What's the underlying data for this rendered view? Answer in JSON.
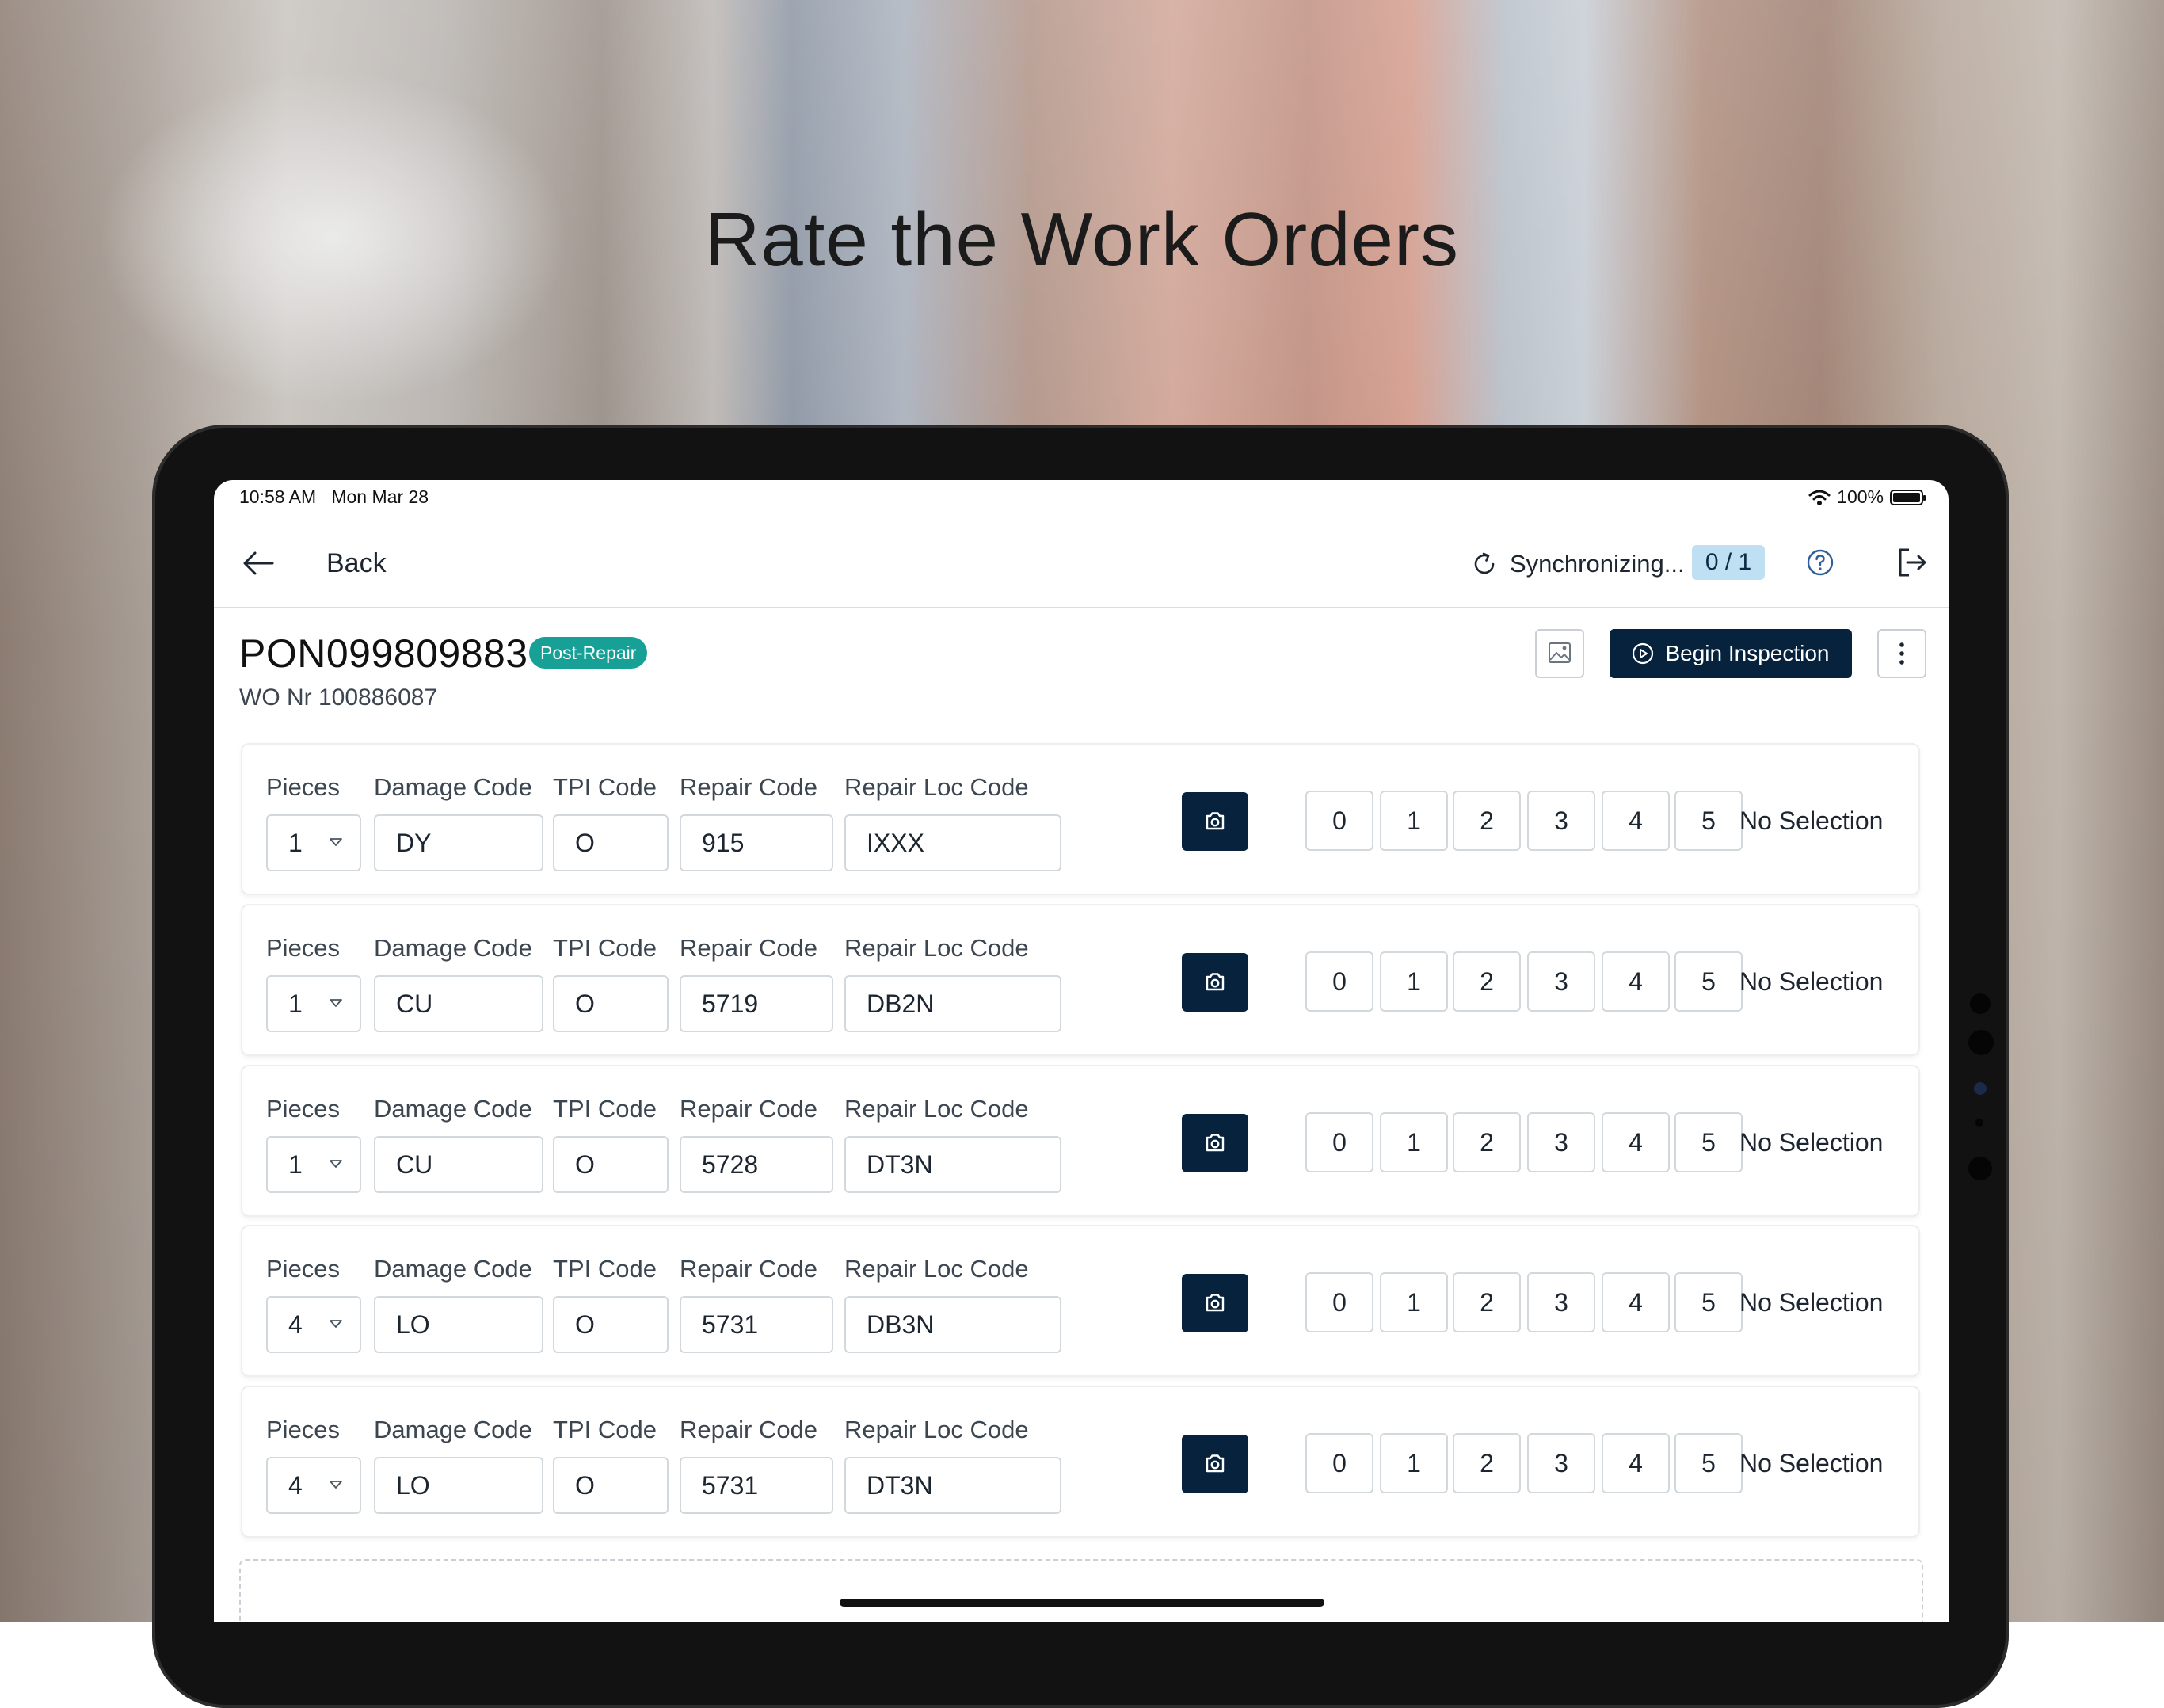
{
  "marketing": {
    "headline": "Rate the Work Orders"
  },
  "status_bar": {
    "time": "10:58 AM",
    "date": "Mon Mar 28",
    "battery": "100%"
  },
  "nav": {
    "back_label": "Back",
    "sync_label": "Synchronizing...",
    "sync_count": "0 / 1"
  },
  "order": {
    "id": "PON099809883",
    "badge": "Post-Repair",
    "wo_nr": "WO Nr 100886087",
    "begin_label": "Begin Inspection"
  },
  "columns": {
    "pieces": "Pieces",
    "damage": "Damage Code",
    "tpi": "TPI Code",
    "repair": "Repair Code",
    "loc": "Repair Loc Code"
  },
  "rating_options": [
    "0",
    "1",
    "2",
    "3",
    "4",
    "5"
  ],
  "rows": [
    {
      "pieces": "1",
      "damage": "DY",
      "tpi": "O",
      "repair": "915",
      "loc": "IXXX",
      "selection": "No Selection"
    },
    {
      "pieces": "1",
      "damage": "CU",
      "tpi": "O",
      "repair": "5719",
      "loc": "DB2N",
      "selection": "No Selection"
    },
    {
      "pieces": "1",
      "damage": "CU",
      "tpi": "O",
      "repair": "5728",
      "loc": "DT3N",
      "selection": "No Selection"
    },
    {
      "pieces": "4",
      "damage": "LO",
      "tpi": "O",
      "repair": "5731",
      "loc": "DB3N",
      "selection": "No Selection"
    },
    {
      "pieces": "4",
      "damage": "LO",
      "tpi": "O",
      "repair": "5731",
      "loc": "DT3N",
      "selection": "No Selection"
    }
  ],
  "colors": {
    "primary": "#06223d",
    "badge": "#16a096",
    "sync_badge": "#bfe0f3"
  },
  "icons": [
    "back-arrow-icon",
    "sync-icon",
    "help-icon",
    "logout-icon",
    "image-icon",
    "play-circle-icon",
    "more-vertical-icon",
    "camera-icon",
    "caret-down-icon",
    "wifi-icon",
    "battery-icon"
  ]
}
